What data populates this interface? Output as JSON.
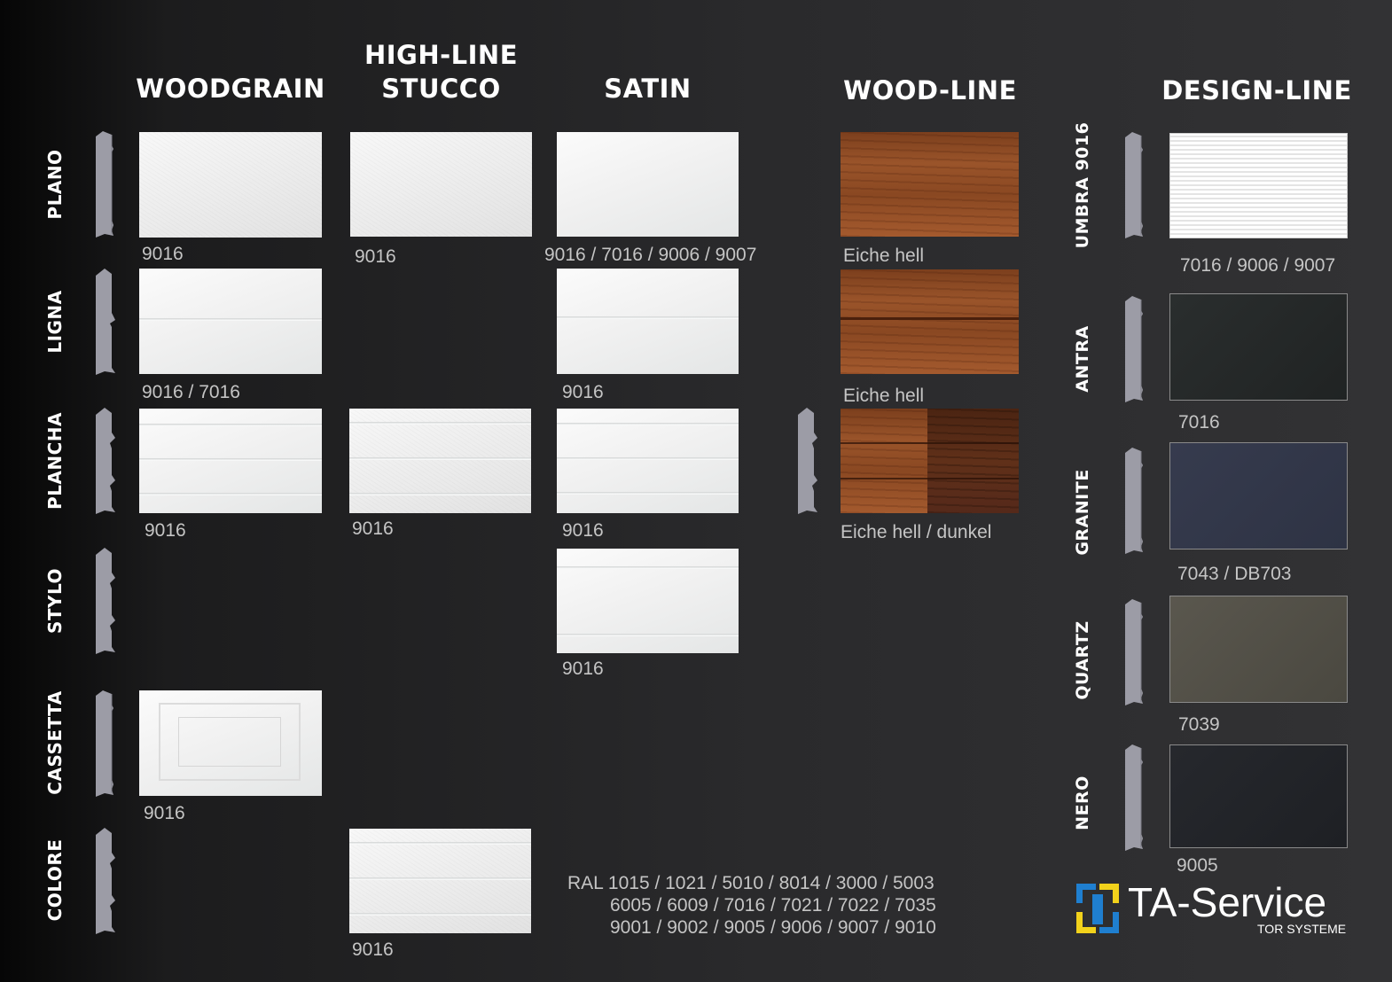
{
  "columns": {
    "woodgrain": "WOODGRAIN",
    "highline_1": "HIGH-LINE",
    "highline_2": "STUCCO",
    "satin": "SATIN",
    "woodline": "WOOD-LINE",
    "designline": "DESIGN-LINE"
  },
  "rows": {
    "plano": "PLANO",
    "ligna": "LIGNA",
    "plancha": "PLANCHA",
    "stylo": "STYLO",
    "cassetta": "CASSETTA",
    "colore": "COLORE"
  },
  "labels": {
    "woodgrain_plano": "9016",
    "woodgrain_ligna": "9016 / 7016",
    "woodgrain_plancha": "9016",
    "woodgrain_cassetta": "9016",
    "highline_plano": "9016",
    "highline_plancha": "9016",
    "highline_colore": "9016",
    "satin_plano": "9016 / 7016 / 9006 / 9007",
    "satin_ligna": "9016",
    "satin_plancha": "9016",
    "satin_stylo": "9016",
    "woodline_plano": "Eiche hell",
    "woodline_ligna": "Eiche hell",
    "woodline_plancha": "Eiche hell / dunkel"
  },
  "ral": {
    "line1": "RAL  1015 / 1021 / 5010 / 8014 / 3000 / 5003",
    "line2": "6005 / 6009 / 7016 / 7021 / 7022 / 7035",
    "line3": "9001 / 9002 / 9005 / 9006 / 9007 / 9010"
  },
  "design_line": [
    {
      "name": "UMBRA 9016",
      "label": "7016 / 9006 / 9007",
      "color": "#f4f4f4"
    },
    {
      "name": "ANTRA",
      "label": "7016",
      "color": "#2a2d2d"
    },
    {
      "name": "GRANITE",
      "label": "7043 / DB703",
      "color": "#33384a"
    },
    {
      "name": "QUARTZ",
      "label": "7039",
      "color": "#555249"
    },
    {
      "name": "NERO",
      "label": "9005",
      "color": "#23252a"
    }
  ],
  "logo": {
    "name": "TA-Service",
    "subtitle": "TOR SYSTEME",
    "colors": {
      "blue": "#1f7fd0",
      "yellow": "#f2d21b"
    }
  }
}
